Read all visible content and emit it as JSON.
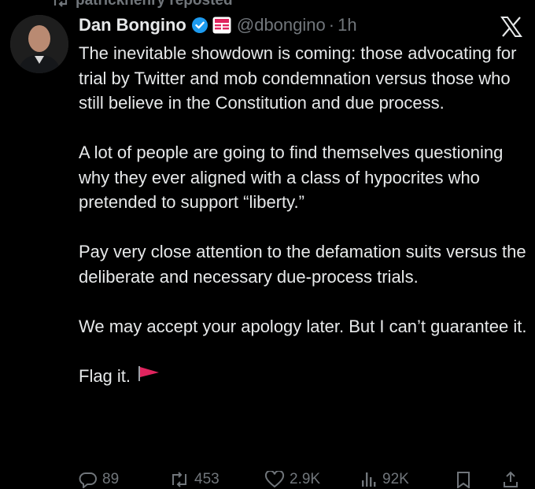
{
  "repost": {
    "text": "patrickhenry reposted"
  },
  "author": {
    "display_name": "Dan Bongino",
    "handle": "@dbongino",
    "separator": "·",
    "timestamp": "1h"
  },
  "tweet": {
    "paragraphs": [
      "The inevitable showdown is coming: those advocating for trial by Twitter and mob condemnation versus those who still believe in the Constitution and due process.",
      "A lot of people are going to find themselves questioning why they ever aligned with a class of hypocrites who pretended to support “liberty.”",
      "Pay very close attention to the defamation suits versus the deliberate and necessary due-process trials.",
      "We may accept your apology later. But I can’t guarantee it.",
      "Flag it."
    ]
  },
  "actions": {
    "replies": "89",
    "reposts": "453",
    "likes": "2.9K",
    "views": "92K"
  },
  "icons": {
    "repost": "repost-icon",
    "verified": "verified-badge-icon",
    "affiliate": "affiliate-badge-icon",
    "logo": "x-logo-icon",
    "flag": "red-flag-icon",
    "reply": "reply-icon",
    "retweet": "retweet-icon",
    "like": "heart-icon",
    "views": "views-icon",
    "bookmark": "bookmark-icon",
    "share": "share-icon"
  },
  "colors": {
    "background": "#000000",
    "text": "#e7e9ea",
    "muted": "#71767b",
    "verified": "#1d9bf0",
    "flag": "#e0245e"
  }
}
